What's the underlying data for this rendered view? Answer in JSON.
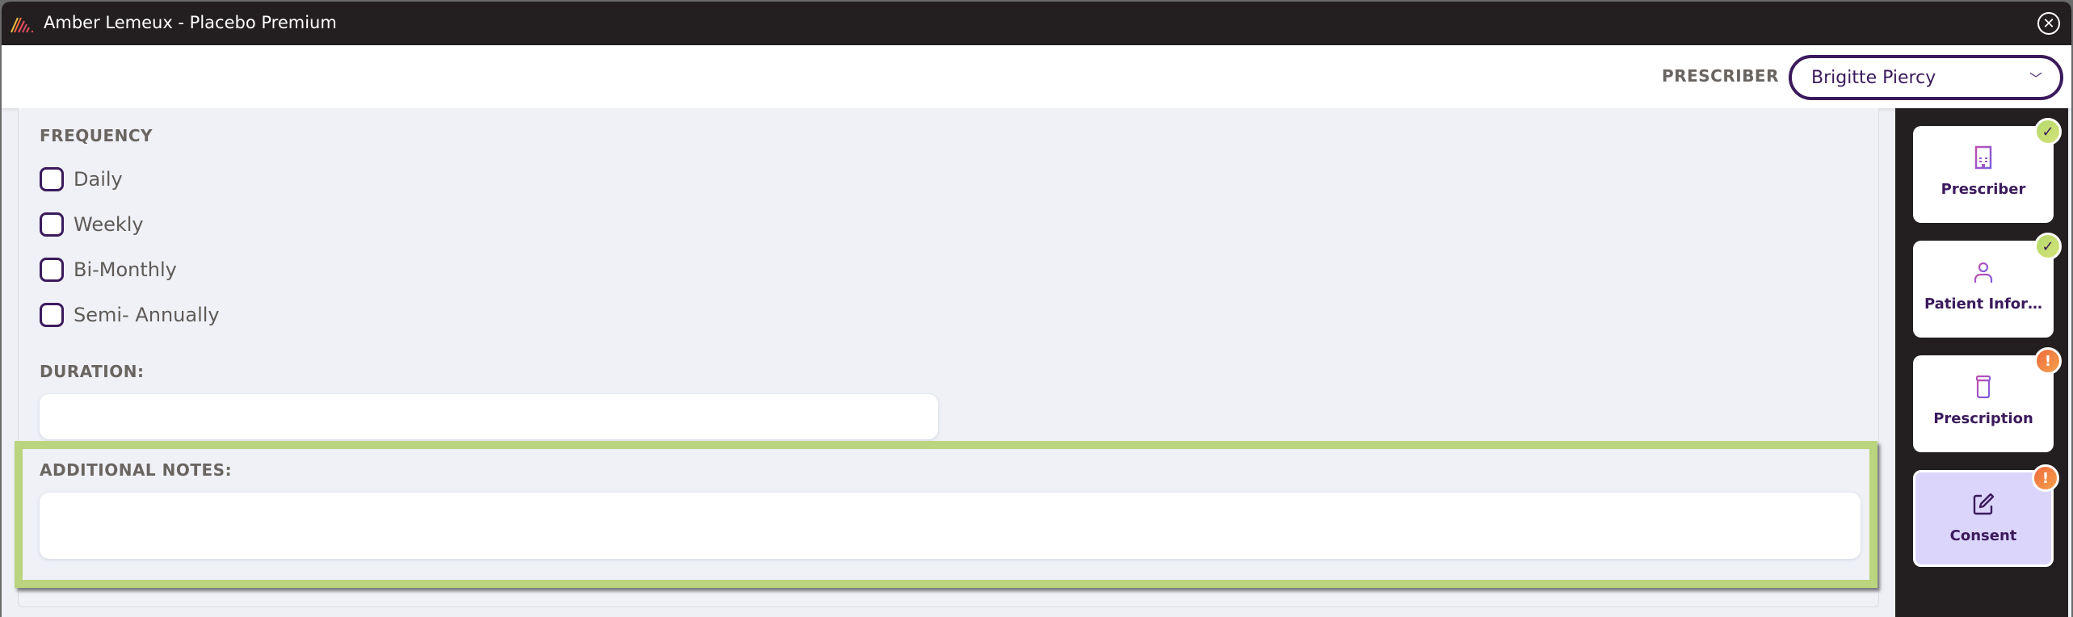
{
  "window": {
    "title": "Amber Lemeux - Placebo Premium",
    "close_icon": "close-circle-icon"
  },
  "header": {
    "prescriber_label": "PRESCRIBER",
    "prescriber_value": "Brigitte  Piercy"
  },
  "form": {
    "frequency": {
      "label": "FREQUENCY",
      "options": [
        {
          "label": "Daily",
          "checked": false
        },
        {
          "label": "Weekly",
          "checked": false
        },
        {
          "label": "Bi-Monthly",
          "checked": false
        },
        {
          "label": "Semi- Annually",
          "checked": false
        }
      ]
    },
    "duration": {
      "label": "DURATION:",
      "value": ""
    },
    "additional_notes": {
      "label": "ADDITIONAL NOTES:",
      "value": ""
    }
  },
  "sidebar": {
    "items": [
      {
        "label": "Prescriber",
        "icon": "hospital-icon",
        "status": "complete",
        "badge": "✓"
      },
      {
        "label": "Patient Infor…",
        "icon": "person-icon",
        "status": "complete",
        "badge": "✓"
      },
      {
        "label": "Prescription",
        "icon": "pill-bottle-icon",
        "status": "warning",
        "badge": "!"
      },
      {
        "label": "Consent",
        "icon": "edit-icon",
        "status": "warning",
        "badge": "!",
        "active": true
      }
    ]
  },
  "colors": {
    "brand_purple": "#3b1a5c",
    "highlight_green": "#bad47f",
    "complete_badge": "#c7dd72",
    "warning_badge": "#f06b3f",
    "active_card": "#dcd5fb",
    "titlebar": "#231f20"
  }
}
